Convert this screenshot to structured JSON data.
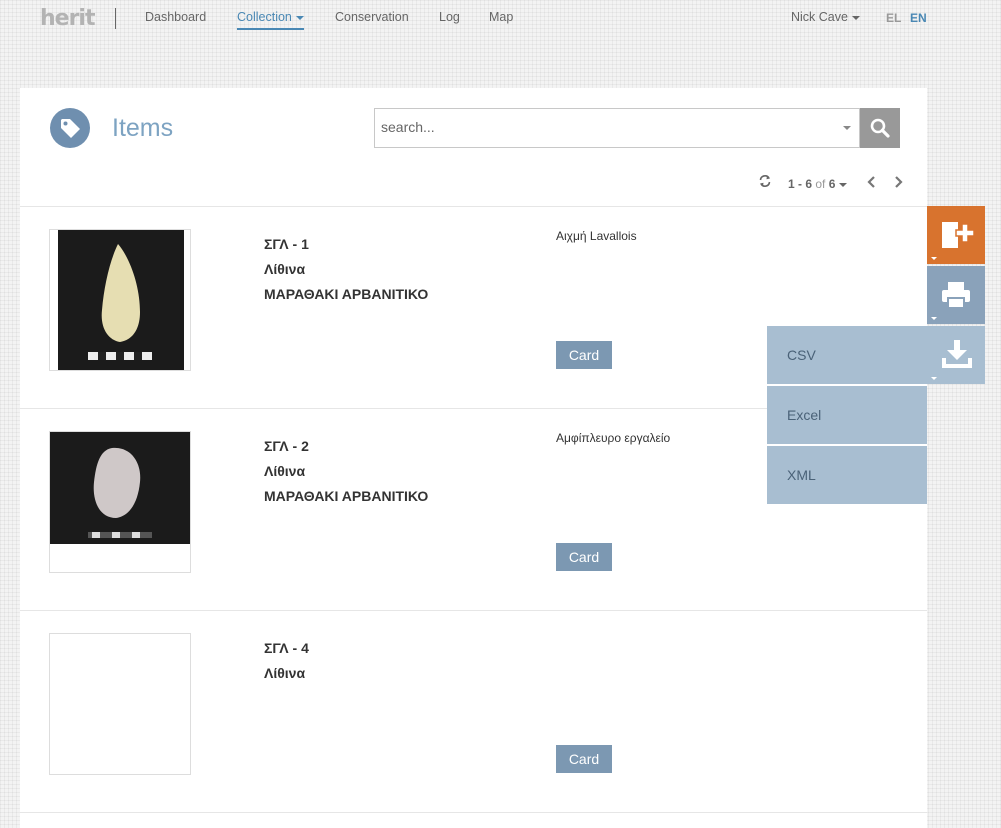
{
  "nav": {
    "logo": "herit",
    "links": [
      "Dashboard",
      "Collection",
      "Conservation",
      "Log",
      "Map"
    ],
    "user": "Nick Cave",
    "lang_el": "EL",
    "lang_en": "EN"
  },
  "page": {
    "title": "Items",
    "search_placeholder": "search..."
  },
  "pager": {
    "range": "1 - 6",
    "of": "of",
    "total": "6"
  },
  "items": [
    {
      "code": "ΣΓΛ - 1",
      "category": "Λίθινα",
      "site": "ΜΑΡΑΘΑΚΙ ΑΡΒΑΝΙΤΙΚΟ",
      "description": "Αιχμή Lavallois",
      "card": "Card"
    },
    {
      "code": "ΣΓΛ - 2",
      "category": "Λίθινα",
      "site": "ΜΑΡΑΘΑΚΙ ΑΡΒΑΝΙΤΙΚΟ",
      "description": "Αμφίπλευρο εργαλείο",
      "card": "Card"
    },
    {
      "code": "ΣΓΛ - 4",
      "category": "Λίθινα",
      "site": "",
      "description": "",
      "card": "Card"
    }
  ],
  "actions": {
    "icons": [
      "add-icon",
      "print-icon",
      "download-icon"
    ],
    "export_options": [
      "CSV",
      "Excel",
      "XML"
    ]
  },
  "colors": {
    "accent": "#4a88b4",
    "add": "#d8732e",
    "print": "#8aa2ba",
    "export": "#a8bed1",
    "card_button": "#7c98b2"
  }
}
